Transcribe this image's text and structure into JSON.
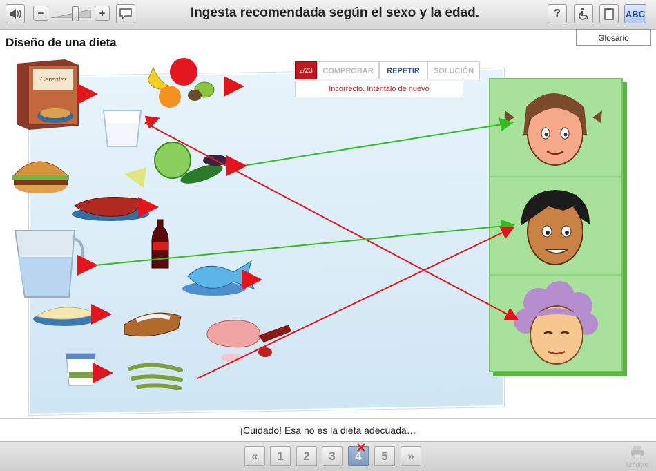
{
  "header": {
    "title": "Ingesta recomendada según el sexo y la edad.",
    "vol_minus": "−",
    "vol_plus": "+",
    "help": "?",
    "abc": "ABC"
  },
  "glossary_label": "Glosario",
  "section_title": "Diseño de una dieta",
  "activity": {
    "page_counter": "2/23",
    "comprobar": "COMPROBAR",
    "repetir": "REPETIR",
    "solucion": "SOLUCIÓN",
    "feedback": "Incorrecto. Inténtalo de nuevo",
    "cereal_box_text": "Cereales"
  },
  "message": "¡Cuidado! Esa no es la dieta adecuada…",
  "pagination": {
    "first": "«",
    "pages": [
      "1",
      "2",
      "3",
      "4",
      "5"
    ],
    "last": "»",
    "current": "4",
    "credits": "Créditos"
  },
  "colors": {
    "wrong_line": "#e3141b",
    "right_line": "#2fbf1c",
    "arrow": "#e3141b",
    "panel": "#a8e29a"
  },
  "icons": [
    "speaker-icon",
    "speech-bubble-icon",
    "help-icon",
    "accessibility-icon",
    "clipboard-icon",
    "printer-icon"
  ]
}
